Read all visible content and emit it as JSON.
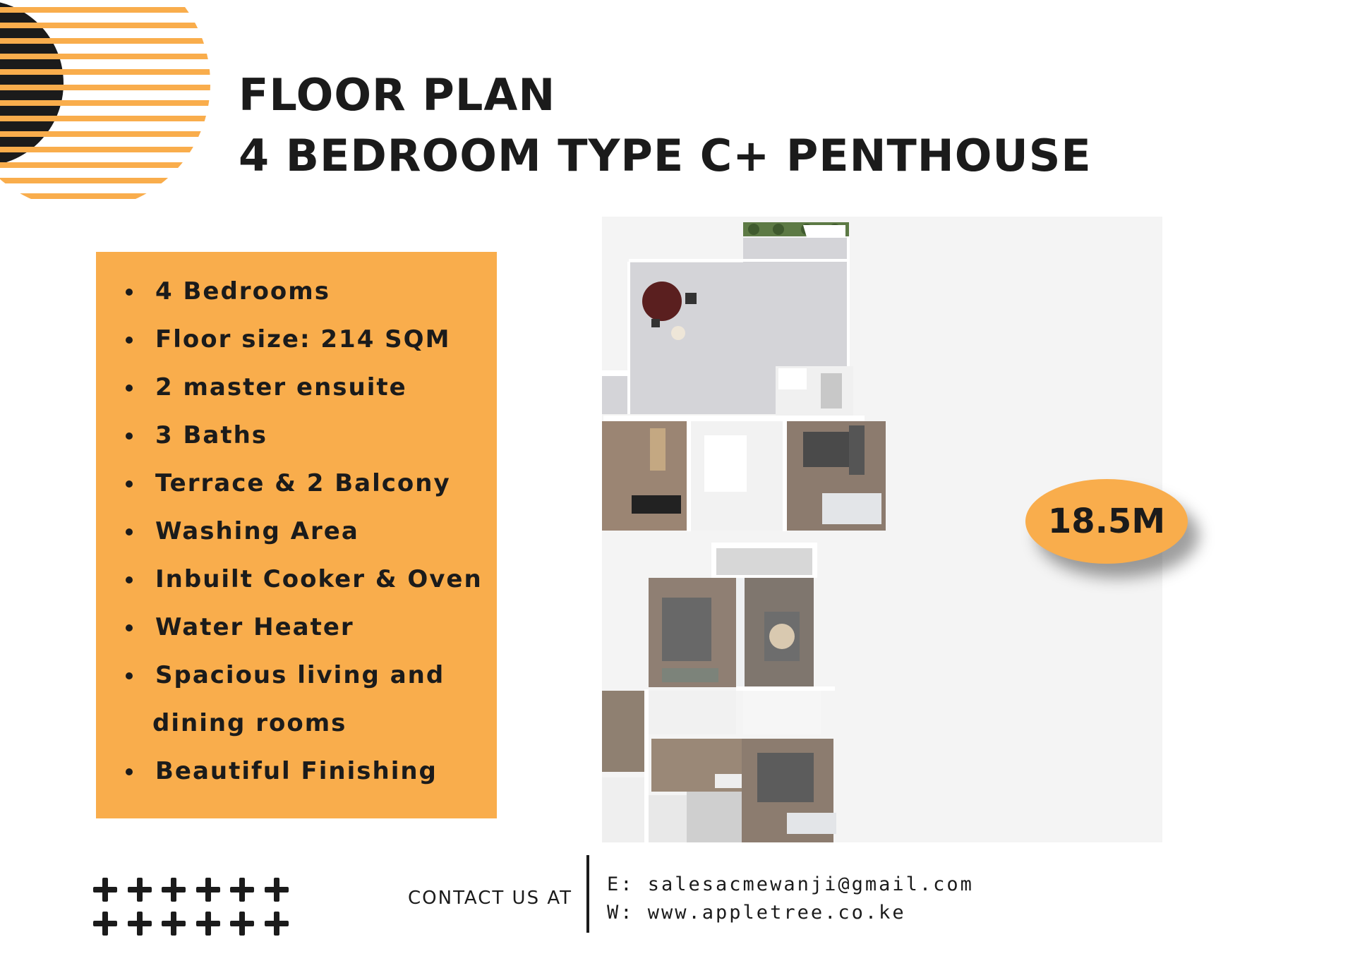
{
  "header": {
    "title_line1": "FLOOR PLAN",
    "title_line2": "4 BEDROOM TYPE C+ PENTHOUSE"
  },
  "features": [
    "4 Bedrooms",
    "Floor size: 214 SQM",
    "2 master ensuite",
    "3 Baths",
    "Terrace & 2 Balcony",
    "Washing Area",
    "Inbuilt Cooker & Oven",
    "Water Heater",
    "Spacious living and",
    "dining rooms",
    "Beautiful Finishing"
  ],
  "price": "18.5M",
  "contact": {
    "label": "CONTACT US AT",
    "email": "E: salesacmewanji@gmail.com",
    "website": "W: www.appletree.co.ke"
  },
  "colors": {
    "accent": "#f9ad4c",
    "dark": "#1b1b1b",
    "panel": "#f4f4f4"
  },
  "icons": [
    "plus-icon",
    "decorative-striped-circle"
  ]
}
